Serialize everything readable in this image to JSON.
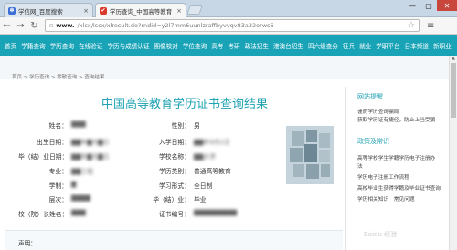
{
  "browser": {
    "tabs": [
      {
        "title": "学信网_百度搜索",
        "icon_color": "#3b6fd6"
      },
      {
        "title": "学历查询_中国高等教育",
        "icon_color": "#d93a2b"
      }
    ],
    "url_host": "www.",
    "url_path": "/xlcx/lscx/xlresult.do?rndid=y2l7mm6uunlzraffbyvvqv83a32orws6",
    "back_icon": "arrow-left-icon",
    "forward_icon": "arrow-right-icon",
    "reload_icon": "reload-icon",
    "star_icon": "star-icon",
    "menu_icon": "menu-icon"
  },
  "nav": {
    "items": [
      "首页",
      "学籍查询",
      "学历查询",
      "在线验证",
      "学历与成绩认证",
      "图像校对",
      "学位查询",
      "高考",
      "考研",
      "政法招生",
      "港澳台招生",
      "四六级查分",
      "征兵",
      "就业",
      "学职平台",
      "日本频道",
      "新职业"
    ]
  },
  "breadcrumb": "首页 > 学历查询 > 零散查询 > 查询结果",
  "result": {
    "title": "中国高等教育学历证书查询结果",
    "fields": [
      {
        "label": "姓名：",
        "value": "▇▇▇",
        "label2": "性别：",
        "value2": "男"
      },
      {
        "label": "出生日期：",
        "value": "▇▇年▇月▇日",
        "label2": "入学日期：",
        "value2": "▇▇年9月1日"
      },
      {
        "label": "毕（结）业日期：",
        "value": "▇▇年▇月▇日",
        "label2": "学校名称：",
        "value2": "▇▇大学"
      },
      {
        "label": "专业：",
        "value": "▇▇工程",
        "label2": "学历类别：",
        "value2": "普通高等教育"
      },
      {
        "label": "学制：",
        "value": "▇",
        "label2": "学习形式：",
        "value2": "全日制"
      },
      {
        "label": "层次：",
        "value": "▇▇▇▇",
        "label2": "毕（结）业：",
        "value2": "毕业"
      },
      {
        "label": "校（院）长姓名：",
        "value": "▇▇▇",
        "label2": "证书编号：",
        "value2": "▇▇▇▇▇▇▇▇▇"
      }
    ],
    "statement_label": "声明："
  },
  "sidebar": {
    "section1_title": "网站提醒",
    "section1_items": [
      "谨防学历查询骗局",
      "获取学历证有捷径，防止上当受骗"
    ],
    "section2_title": "政策及常识",
    "section2_items": [
      "高等学校学生学籍学历电子注册办",
      "法",
      "学历电子注册工作流程",
      "高校毕业生获得学籍及毕业证书查询",
      "学历相关知识　常见问题"
    ]
  },
  "watermark": "Baidu 经验",
  "colors": {
    "accent": "#19a3b7",
    "title": "#1fa2b3"
  }
}
